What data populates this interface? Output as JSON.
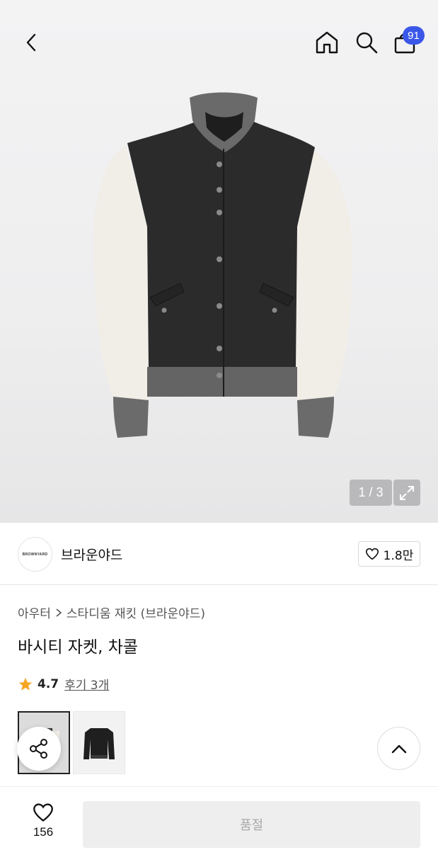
{
  "header": {
    "cart_count": "91",
    "icons": [
      "back-arrow-icon",
      "home-icon",
      "search-icon",
      "shopping-bag-icon"
    ]
  },
  "gallery": {
    "counter": "1 / 3",
    "expand_icon": "expand-icon"
  },
  "brand": {
    "logo_text": "BROWNYARD",
    "name": "브라운야드",
    "likes": "1.8만"
  },
  "product": {
    "breadcrumb": [
      "아우터",
      "스타디움 재킷 (브라운야드)"
    ],
    "title": "바시티 자켓, 차콜",
    "rating": "4.7",
    "reviews": "후기 3개",
    "star_color": "#f5a623"
  },
  "bottom": {
    "wish_count": "156",
    "soldout_label": "품절"
  },
  "colors": {
    "accent_badge": "#3b57e8",
    "disabled_button": "#eeeeee"
  }
}
